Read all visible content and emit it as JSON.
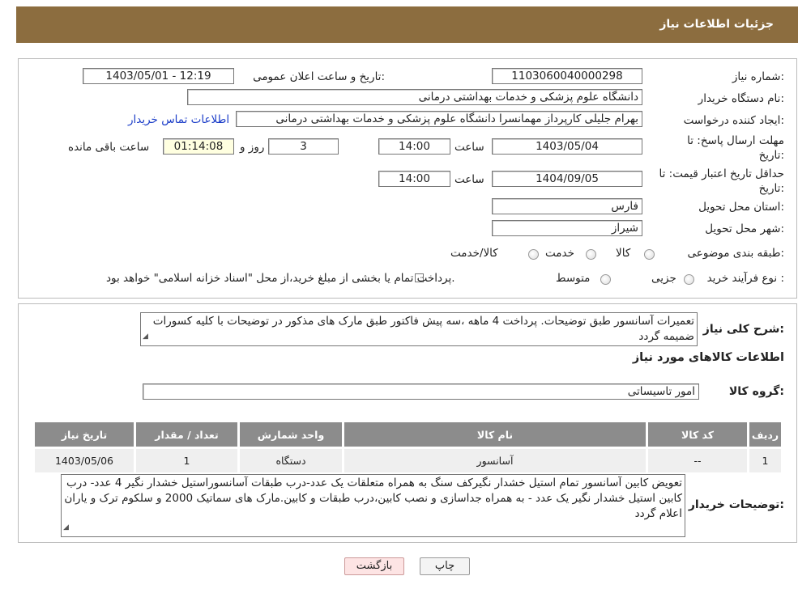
{
  "header": {
    "title": "جزئیات اطلاعات نیاز"
  },
  "fields": {
    "need_number_label": "شماره نیاز:",
    "need_number": "1103060040000298",
    "announce_label": "تاریخ و ساعت اعلان عمومی:",
    "announce_value": "1403/05/01 - 12:19",
    "buyer_org_label": "نام دستگاه خریدار:",
    "buyer_org": "دانشگاه علوم پزشکی و خدمات بهداشتی درمانی",
    "creator_label": "ایجاد کننده درخواست:",
    "creator": "بهرام جلیلی کارپرداز مهمانسرا دانشگاه علوم پزشکی و خدمات بهداشتی درمانی",
    "contact_link": "اطلاعات تماس خریدار",
    "deadline_label": "مهلت ارسال پاسخ: تا تاریخ:",
    "deadline_date": "1403/05/04",
    "time_word": "ساعت",
    "deadline_time": "14:00",
    "days_value": "3",
    "days_and": "روز و",
    "remaining_time": "01:14:08",
    "remaining_label": "ساعت باقی مانده",
    "validity_label": "حداقل تاریخ اعتبار قیمت: تا تاریخ:",
    "validity_date": "1404/09/05",
    "validity_time": "14:00",
    "province_label": "استان محل تحویل:",
    "province": "فارس",
    "city_label": "شهر محل تحویل:",
    "city": "شیراز",
    "category_label": "طبقه بندی موضوعی:",
    "category_options": [
      "کالا",
      "خدمت",
      "کالا/خدمت"
    ],
    "process_label": "نوع فرآیند خرید :",
    "process_options": [
      "جزیی",
      "متوسط"
    ],
    "process_note": "پرداخت تمام یا بخشی از مبلغ خرید،از محل \"اسناد خزانه اسلامی\" خواهد بود."
  },
  "description": {
    "label": "شرح کلی نیاز:",
    "text": "تعمیرات آسانسور طبق توضیحات. پرداخت 4 ماهه ،سه پیش فاکتور طبق مارک های مذکور در توضیحات با کلیه کسورات ضمیمه گردد"
  },
  "items_section": {
    "title": "اطلاعات کالاهای مورد نیاز",
    "group_label": "گروه کالا:",
    "group_value": "امور تاسیساتی"
  },
  "table": {
    "headers": [
      "ردیف",
      "کد کالا",
      "نام کالا",
      "واحد شمارش",
      "تعداد / مقدار",
      "تاریخ نیاز"
    ],
    "rows": [
      [
        "1",
        "--",
        "آسانسور",
        "دستگاه",
        "1",
        "1403/05/06"
      ]
    ]
  },
  "buyer_notes": {
    "label": "توضیحات خریدار:",
    "text": "تعویض کابین آسانسور تمام استیل خشدار نگیرکف سنگ به همراه متعلقات یک عدد-درب طبقات آسانسوراستیل خشدار نگیر 4 عدد- درب کابین استیل خشدار نگیر یک عدد - به همراه جداسازی و نصب کابین،درب طبقات و کابین.مارک های سماتیک 2000 و سلکوم ترک و یاران اعلام گردد"
  },
  "buttons": {
    "print": "چاپ",
    "back": "بازگشت"
  },
  "colors": {
    "header_bg": "#8c6d3f",
    "link": "#1a3cc8",
    "table_header": "#8c8c8c"
  }
}
